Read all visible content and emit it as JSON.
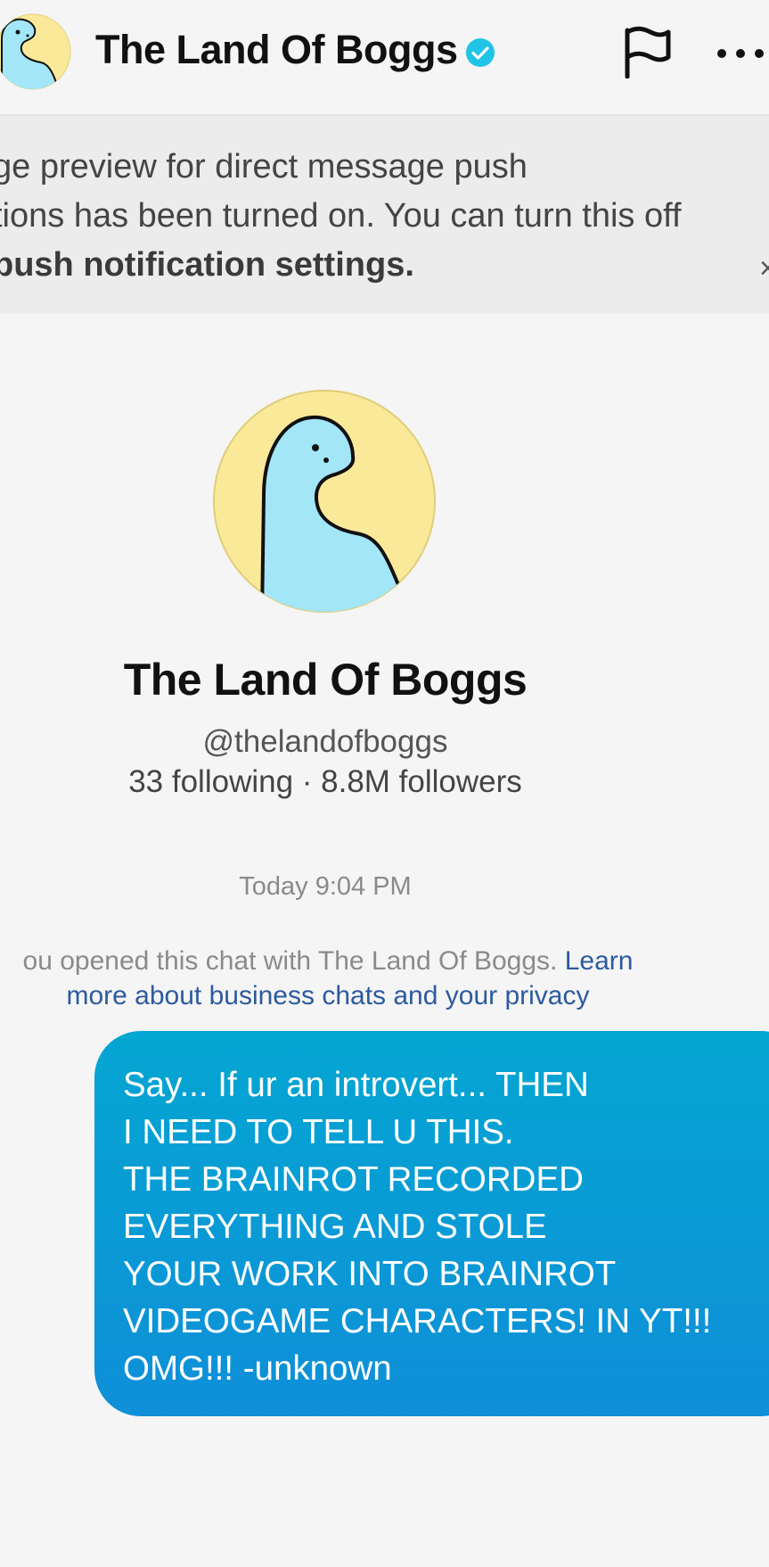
{
  "header": {
    "title": "The Land Of Boggs",
    "verified_icon": "verified-badge-icon",
    "flag_icon": "flag-icon",
    "more_icon": "more-dots-icon"
  },
  "banner": {
    "line1": "ge preview for direct message push",
    "line2": "tions has been turned on. You can turn this off",
    "line3": "push notification settings.",
    "close_symbol": "×"
  },
  "profile": {
    "name": "The Land Of Boggs",
    "handle": "@thelandofboggs",
    "stats": "33 following · 8.8M followers"
  },
  "chat": {
    "timestamp": "Today 9:04 PM",
    "notice_line1_text": "ou opened this chat with The Land Of Boggs. ",
    "notice_line1_link": "Learn",
    "notice_line2_link": "more about business chats and your privacy",
    "message_lines": [
      "Say... If ur an introvert... THEN",
      "I NEED TO TELL U THIS.",
      "THE BRAINROT RECORDED",
      "EVERYTHING AND STOLE",
      "YOUR WORK INTO BRAINROT",
      "VIDEOGAME CHARACTERS! IN YT!!!",
      "OMG!!! -unknown"
    ]
  },
  "colors": {
    "avatar_bg": "#fbe99a",
    "dino": "#a2e6f8",
    "bubble_top": "#04a6d2",
    "bubble_bottom": "#0f8fd8",
    "link": "#2c5a9e",
    "verified": "#20c4e6"
  }
}
